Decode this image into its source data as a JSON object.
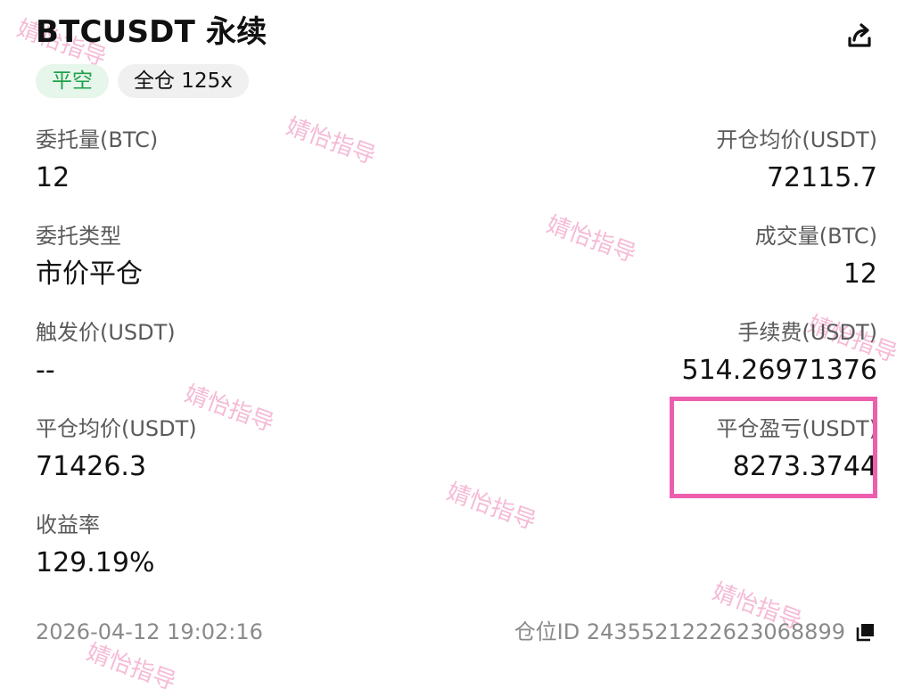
{
  "header": {
    "title": "BTCUSDT 永续",
    "share_icon": "share-icon"
  },
  "tags": {
    "position_side": "平空",
    "margin_mode": "全仓 125x"
  },
  "fields": {
    "order_qty": {
      "label": "委托量(BTC)",
      "value": "12"
    },
    "open_avg_price": {
      "label": "开仓均价(USDT)",
      "value": "72115.7"
    },
    "order_type": {
      "label": "委托类型",
      "value": "市价平仓"
    },
    "filled_qty": {
      "label": "成交量(BTC)",
      "value": "12"
    },
    "trigger_price": {
      "label": "触发价(USDT)",
      "value": "--"
    },
    "fee": {
      "label": "手续费(USDT)",
      "value": "514.26971376"
    },
    "close_avg_price": {
      "label": "平仓均价(USDT)",
      "value": "71426.3"
    },
    "close_pnl": {
      "label": "平仓盈亏(USDT)",
      "value": "8273.3744"
    },
    "roi": {
      "label": "收益率",
      "value": "129.19%"
    }
  },
  "footer": {
    "datetime": "2026-04-12 19:02:16",
    "position_id": "仓位ID 2435521222623068899",
    "copy_icon": "copy-icon"
  },
  "watermark": {
    "text": "婧怡指导"
  },
  "colors": {
    "accent_green": "#1fa14a",
    "highlight_pink": "#ec5fae",
    "watermark_pink": "#f2a4c9"
  }
}
